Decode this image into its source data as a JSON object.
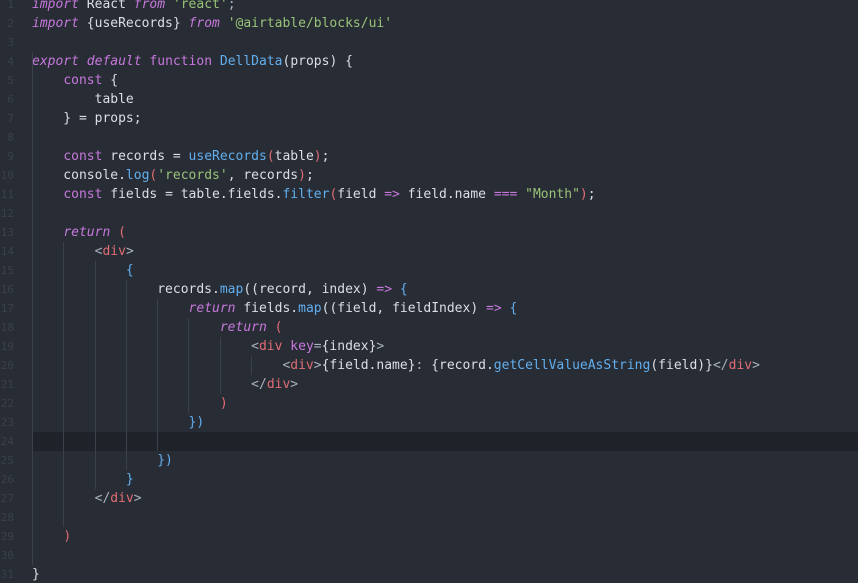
{
  "editor": {
    "theme_colors": {
      "background": "#282c34",
      "keyword": "#c678dd",
      "function": "#61afef",
      "string": "#98c379",
      "tag": "#e06c75",
      "text": "#dadfe6"
    },
    "lines": [
      {
        "tokens": [
          {
            "t": "import",
            "c": "kwi"
          },
          {
            "t": " React ",
            "c": ""
          },
          {
            "t": "from",
            "c": "kwi"
          },
          {
            "t": " ",
            "c": ""
          },
          {
            "t": "'react'",
            "c": "st"
          },
          {
            "t": ";",
            "c": "pn"
          }
        ]
      },
      {
        "tokens": [
          {
            "t": "import",
            "c": "kwi"
          },
          {
            "t": " {useRecords} ",
            "c": ""
          },
          {
            "t": "from",
            "c": "kwi"
          },
          {
            "t": " ",
            "c": ""
          },
          {
            "t": "'@airtable/blocks/ui'",
            "c": "st"
          }
        ]
      },
      {
        "tokens": []
      },
      {
        "tokens": [
          {
            "t": "export",
            "c": "kwi"
          },
          {
            "t": " ",
            "c": ""
          },
          {
            "t": "default",
            "c": "kwi"
          },
          {
            "t": " ",
            "c": ""
          },
          {
            "t": "function",
            "c": "kw"
          },
          {
            "t": " ",
            "c": ""
          },
          {
            "t": "DellData",
            "c": "fn"
          },
          {
            "t": "(props) {",
            "c": ""
          }
        ]
      },
      {
        "tokens": [
          {
            "t": "    ",
            "c": ""
          },
          {
            "t": "const",
            "c": "kw"
          },
          {
            "t": " {",
            "c": ""
          }
        ]
      },
      {
        "tokens": [
          {
            "t": "        table",
            "c": ""
          }
        ]
      },
      {
        "tokens": [
          {
            "t": "    } = props;",
            "c": ""
          }
        ]
      },
      {
        "tokens": []
      },
      {
        "tokens": [
          {
            "t": "    ",
            "c": ""
          },
          {
            "t": "const",
            "c": "kw"
          },
          {
            "t": " records = ",
            "c": ""
          },
          {
            "t": "useRecords",
            "c": "fn"
          },
          {
            "t": "(",
            "c": "pr"
          },
          {
            "t": "table",
            "c": ""
          },
          {
            "t": ")",
            "c": "pr"
          },
          {
            "t": ";",
            "c": ""
          }
        ]
      },
      {
        "tokens": [
          {
            "t": "    console.",
            "c": ""
          },
          {
            "t": "log",
            "c": "fn"
          },
          {
            "t": "(",
            "c": "pr"
          },
          {
            "t": "'records'",
            "c": "st"
          },
          {
            "t": ", records",
            "c": ""
          },
          {
            "t": ")",
            "c": "pr"
          },
          {
            "t": ";",
            "c": ""
          }
        ]
      },
      {
        "tokens": [
          {
            "t": "    ",
            "c": ""
          },
          {
            "t": "const",
            "c": "kw"
          },
          {
            "t": " fields = table.fields.",
            "c": ""
          },
          {
            "t": "filter",
            "c": "fn"
          },
          {
            "t": "(",
            "c": "pr"
          },
          {
            "t": "field ",
            "c": ""
          },
          {
            "t": "=>",
            "c": "kw"
          },
          {
            "t": " field.name ",
            "c": ""
          },
          {
            "t": "===",
            "c": "kw"
          },
          {
            "t": " ",
            "c": ""
          },
          {
            "t": "\"Month\"",
            "c": "st"
          },
          {
            "t": ")",
            "c": "pr"
          },
          {
            "t": ";",
            "c": ""
          }
        ]
      },
      {
        "tokens": []
      },
      {
        "tokens": [
          {
            "t": "    ",
            "c": ""
          },
          {
            "t": "return",
            "c": "kwi"
          },
          {
            "t": " ",
            "c": ""
          },
          {
            "t": "(",
            "c": "pr"
          }
        ]
      },
      {
        "tokens": [
          {
            "t": "        ",
            "c": ""
          },
          {
            "t": "<",
            "c": "pn"
          },
          {
            "t": "div",
            "c": "tg"
          },
          {
            "t": ">",
            "c": "pn"
          }
        ]
      },
      {
        "tokens": [
          {
            "t": "            {",
            "c": "fn"
          }
        ]
      },
      {
        "tokens": [
          {
            "t": "                records.",
            "c": ""
          },
          {
            "t": "map",
            "c": "fn"
          },
          {
            "t": "((",
            "c": ""
          },
          {
            "t": "record, index",
            "c": ""
          },
          {
            "t": ") ",
            "c": ""
          },
          {
            "t": "=>",
            "c": "kw"
          },
          {
            "t": " ",
            "c": ""
          },
          {
            "t": "{",
            "c": "fn"
          }
        ]
      },
      {
        "tokens": [
          {
            "t": "                    ",
            "c": ""
          },
          {
            "t": "return",
            "c": "kwi"
          },
          {
            "t": " fields.",
            "c": ""
          },
          {
            "t": "map",
            "c": "fn"
          },
          {
            "t": "((",
            "c": ""
          },
          {
            "t": "field, fieldIndex",
            "c": ""
          },
          {
            "t": ") ",
            "c": ""
          },
          {
            "t": "=>",
            "c": "kw"
          },
          {
            "t": " {",
            "c": "fn"
          }
        ]
      },
      {
        "tokens": [
          {
            "t": "                        ",
            "c": ""
          },
          {
            "t": "return",
            "c": "kwi"
          },
          {
            "t": " ",
            "c": ""
          },
          {
            "t": "(",
            "c": "pr"
          }
        ]
      },
      {
        "tokens": [
          {
            "t": "                            ",
            "c": ""
          },
          {
            "t": "<",
            "c": "pn"
          },
          {
            "t": "div",
            "c": "tg"
          },
          {
            "t": " ",
            "c": ""
          },
          {
            "t": "key",
            "c": "kw"
          },
          {
            "t": "=",
            "c": "pn"
          },
          {
            "t": "{index}",
            "c": ""
          },
          {
            "t": ">",
            "c": "pn"
          }
        ]
      },
      {
        "tokens": [
          {
            "t": "                                ",
            "c": ""
          },
          {
            "t": "<",
            "c": "pn"
          },
          {
            "t": "div",
            "c": "tg"
          },
          {
            "t": ">",
            "c": "pn"
          },
          {
            "t": "{field.name}",
            "c": ""
          },
          {
            "t": ": ",
            "c": "pn"
          },
          {
            "t": "{record.",
            "c": ""
          },
          {
            "t": "getCellValueAsString",
            "c": "fn"
          },
          {
            "t": "(field)}",
            "c": ""
          },
          {
            "t": "</",
            "c": "pn"
          },
          {
            "t": "div",
            "c": "tg"
          },
          {
            "t": ">",
            "c": "pn"
          }
        ]
      },
      {
        "tokens": [
          {
            "t": "                            ",
            "c": ""
          },
          {
            "t": "</",
            "c": "pn"
          },
          {
            "t": "div",
            "c": "tg"
          },
          {
            "t": ">",
            "c": "pn"
          }
        ]
      },
      {
        "tokens": [
          {
            "t": "                        ",
            "c": ""
          },
          {
            "t": ")",
            "c": "pr"
          }
        ]
      },
      {
        "tokens": [
          {
            "t": "                    ",
            "c": ""
          },
          {
            "t": "})",
            "c": "fn"
          }
        ]
      },
      {
        "tokens": [],
        "active": true
      },
      {
        "tokens": [
          {
            "t": "                ",
            "c": ""
          },
          {
            "t": "})",
            "c": "fn"
          }
        ]
      },
      {
        "tokens": [
          {
            "t": "            ",
            "c": ""
          },
          {
            "t": "}",
            "c": "fn"
          }
        ]
      },
      {
        "tokens": [
          {
            "t": "        ",
            "c": ""
          },
          {
            "t": "</",
            "c": "pn"
          },
          {
            "t": "div",
            "c": "tg"
          },
          {
            "t": ">",
            "c": "pn"
          }
        ]
      },
      {
        "tokens": []
      },
      {
        "tokens": [
          {
            "t": "    ",
            "c": ""
          },
          {
            "t": ")",
            "c": "pr"
          }
        ]
      },
      {
        "tokens": []
      },
      {
        "tokens": [
          {
            "t": "}",
            "c": ""
          }
        ]
      }
    ]
  }
}
